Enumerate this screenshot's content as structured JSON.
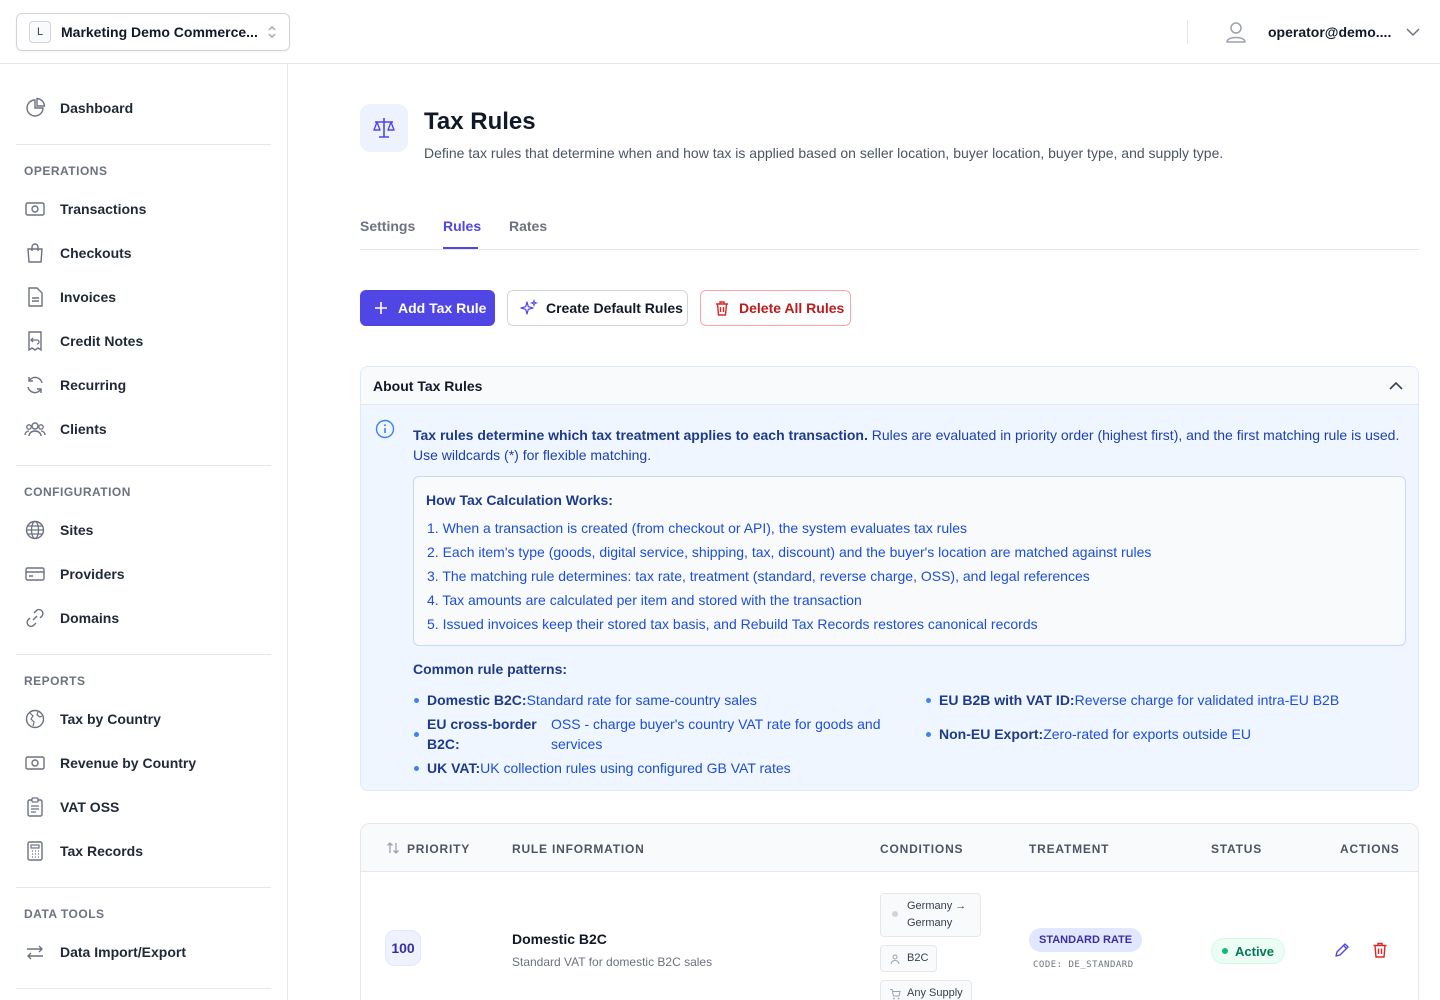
{
  "topbar": {
    "workspace_initial": "L",
    "workspace_name": "Marketing Demo Commerce...",
    "user_email": "operator@demo...."
  },
  "sidebar": {
    "dashboard": "Dashboard",
    "sections": {
      "operations": "OPERATIONS",
      "configuration": "CONFIGURATION",
      "reports": "REPORTS",
      "data_tools": "DATA TOOLS"
    },
    "operations": [
      "Transactions",
      "Checkouts",
      "Invoices",
      "Credit Notes",
      "Recurring",
      "Clients"
    ],
    "configuration": [
      "Sites",
      "Providers",
      "Domains"
    ],
    "reports": [
      "Tax by Country",
      "Revenue by Country",
      "VAT OSS",
      "Tax Records"
    ],
    "data_tools": [
      "Data Import/Export"
    ]
  },
  "page": {
    "title": "Tax Rules",
    "description": "Define tax rules that determine when and how tax is applied based on seller location, buyer location, buyer type, and supply type.",
    "tabs": [
      "Settings",
      "Rules",
      "Rates"
    ],
    "active_tab": "Rules"
  },
  "actions": {
    "add": "Add Tax Rule",
    "create_default": "Create Default Rules",
    "delete_all": "Delete All Rules"
  },
  "about": {
    "title": "About Tax Rules",
    "intro_bold": "Tax rules determine which tax treatment applies to each transaction.",
    "intro_rest": " Rules are evaluated in priority order (highest first), and the first matching rule is used. Use wildcards (*) for flexible matching.",
    "how_title": "How Tax Calculation Works:",
    "steps": [
      "1. When a transaction is created (from checkout or API), the system evaluates tax rules",
      "2. Each item's type (goods, digital service, shipping, tax, discount) and the buyer's location are matched against rules",
      "3. The matching rule determines: tax rate, treatment (standard, reverse charge, OSS), and legal references",
      "4. Tax amounts are calculated per item and stored with the transaction",
      "5. Issued invoices keep their stored tax basis, and Rebuild Tax Records restores canonical records"
    ],
    "patterns_title": "Common rule patterns:",
    "patterns": [
      {
        "label": "Domestic B2C:",
        "text": "Standard rate for same-country sales"
      },
      {
        "label": "EU B2B with VAT ID:",
        "text": "Reverse charge for validated intra-EU B2B"
      },
      {
        "label": "EU cross-border B2C:",
        "text": "OSS - charge buyer's country VAT rate for goods and services"
      },
      {
        "label": "Non-EU Export:",
        "text": "Zero-rated for exports outside EU"
      },
      {
        "label": "UK VAT:",
        "text": "UK collection rules using configured GB VAT rates"
      }
    ]
  },
  "table": {
    "headers": [
      "PRIORITY",
      "RULE INFORMATION",
      "CONDITIONS",
      "TREATMENT",
      "STATUS",
      "ACTIONS"
    ],
    "rows": [
      {
        "priority": "100",
        "name": "Domestic B2C",
        "description": "Standard VAT for domestic B2C sales",
        "conditions": [
          "Germany → Germany",
          "B2C",
          "Any Supply"
        ],
        "treatment": "STANDARD RATE",
        "code": "CODE: DE_STANDARD",
        "status": "Active"
      }
    ]
  }
}
